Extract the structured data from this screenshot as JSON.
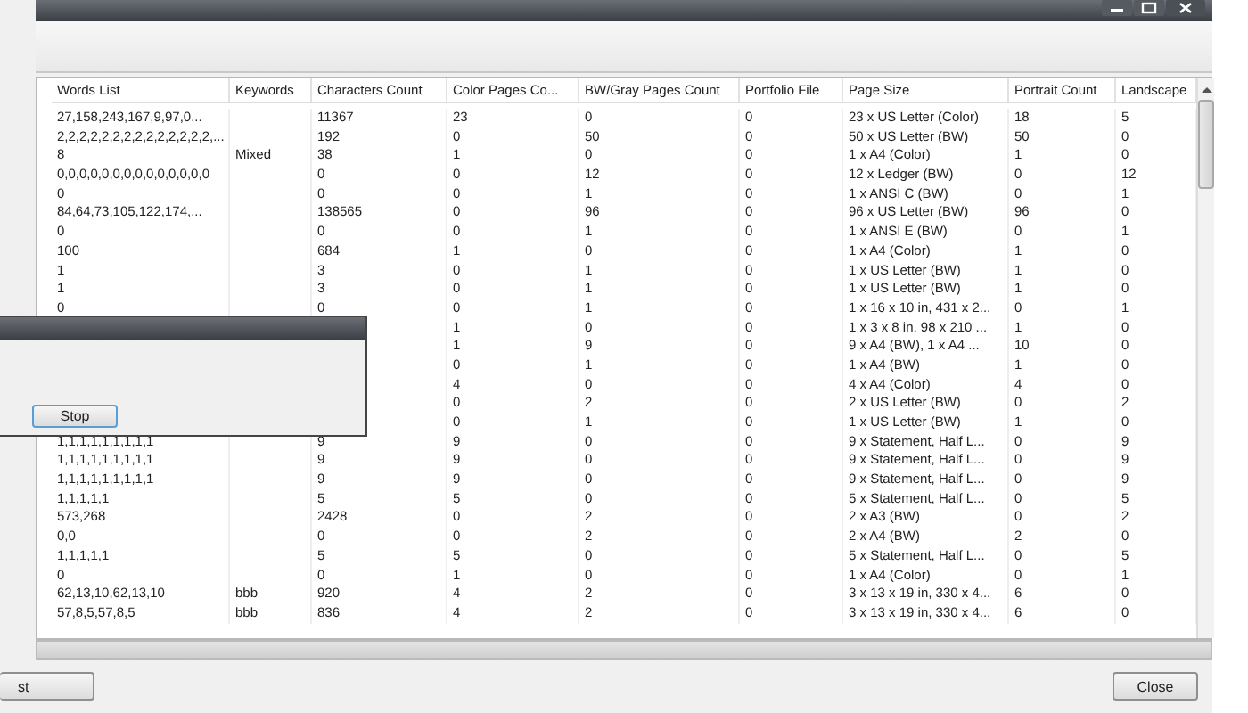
{
  "table": {
    "columns": [
      "Words List",
      "Keywords",
      "Characters Count",
      "Color Pages Co...",
      "BW/Gray Pages Count",
      "Portfolio File",
      "Page Size",
      "Portrait Count",
      "Landscape"
    ],
    "rows": [
      {
        "words": "27,158,243,167,9,97,0...",
        "chars": "11367",
        "color_pages": "23",
        "bw_pages": "0",
        "portfolio": "0",
        "page_size": "23 x US Letter  (Color)",
        "portrait": "18",
        "landscape": "5"
      },
      {
        "words": "2,2,2,2,2,2,2,2,2,2,2,2,2,2,...",
        "chars": "192",
        "color_pages": "0",
        "bw_pages": "50",
        "portfolio": "0",
        "page_size": "50 x US Letter  (BW)",
        "portrait": "50",
        "landscape": "0"
      },
      {
        "words": "8",
        "keywords": "Mixed",
        "chars": "38",
        "color_pages": "1",
        "bw_pages": "0",
        "portfolio": "0",
        "page_size": "1 x A4  (Color)",
        "portrait": "1",
        "landscape": "0"
      },
      {
        "words": "0,0,0,0,0,0,0,0,0,0,0,0,0,0",
        "chars": "0",
        "color_pages": "0",
        "bw_pages": "12",
        "portfolio": "0",
        "page_size": "12 x Ledger  (BW)",
        "portrait": "0",
        "landscape": "12"
      },
      {
        "words": "0",
        "chars": "0",
        "color_pages": "0",
        "bw_pages": "1",
        "portfolio": "0",
        "page_size": "1 x ANSI C  (BW)",
        "portrait": "0",
        "landscape": "1"
      },
      {
        "words": "84,64,73,105,122,174,...",
        "chars": "138565",
        "color_pages": "0",
        "bw_pages": "96",
        "portfolio": "0",
        "page_size": "96 x US Letter  (BW)",
        "portrait": "96",
        "landscape": "0"
      },
      {
        "words": "0",
        "chars": "0",
        "color_pages": "0",
        "bw_pages": "1",
        "portfolio": "0",
        "page_size": "1 x ANSI E  (BW)",
        "portrait": "0",
        "landscape": "1"
      },
      {
        "words": "100",
        "chars": "684",
        "color_pages": "1",
        "bw_pages": "0",
        "portfolio": "0",
        "page_size": "1 x A4  (Color)",
        "portrait": "1",
        "landscape": "0"
      },
      {
        "words": "1",
        "chars": "3",
        "color_pages": "0",
        "bw_pages": "1",
        "portfolio": "0",
        "page_size": "1 x US Letter  (BW)",
        "portrait": "1",
        "landscape": "0"
      },
      {
        "words": "1",
        "chars": "3",
        "color_pages": "0",
        "bw_pages": "1",
        "portfolio": "0",
        "page_size": "1 x US Letter  (BW)",
        "portrait": "1",
        "landscape": "0"
      },
      {
        "words": "0",
        "chars": "0",
        "color_pages": "0",
        "bw_pages": "1",
        "portfolio": "0",
        "page_size": "1 x 16 x 10 in, 431 x 2...",
        "portrait": "0",
        "landscape": "1"
      },
      {
        "color_pages": "1",
        "bw_pages": "0",
        "portfolio": "0",
        "page_size": "1 x 3 x 8 in, 98 x 210 ...",
        "portrait": "1",
        "landscape": "0"
      },
      {
        "color_pages": "1",
        "bw_pages": "9",
        "portfolio": "0",
        "page_size": "9 x A4  (BW), 1 x A4  ...",
        "portrait": "10",
        "landscape": "0"
      },
      {
        "color_pages": "0",
        "bw_pages": "1",
        "portfolio": "0",
        "page_size": "1 x A4  (BW)",
        "portrait": "1",
        "landscape": "0"
      },
      {
        "color_pages": "4",
        "bw_pages": "0",
        "portfolio": "0",
        "page_size": "4 x A4  (Color)",
        "portrait": "4",
        "landscape": "0"
      },
      {
        "color_pages": "0",
        "bw_pages": "2",
        "portfolio": "0",
        "page_size": "2 x US Letter  (BW)",
        "portrait": "0",
        "landscape": "2"
      },
      {
        "color_pages": "0",
        "bw_pages": "1",
        "portfolio": "0",
        "page_size": "1 x US Letter  (BW)",
        "portrait": "1",
        "landscape": "0"
      },
      {
        "words": "1,1,1,1,1,1,1,1,1",
        "chars": "9",
        "color_pages": "9",
        "bw_pages": "0",
        "portfolio": "0",
        "page_size": "9 x Statement, Half L...",
        "portrait": "0",
        "landscape": "9"
      },
      {
        "words": "1,1,1,1,1,1,1,1,1",
        "chars": "9",
        "color_pages": "9",
        "bw_pages": "0",
        "portfolio": "0",
        "page_size": "9 x Statement, Half L...",
        "portrait": "0",
        "landscape": "9"
      },
      {
        "words": "1,1,1,1,1,1,1,1,1",
        "chars": "9",
        "color_pages": "9",
        "bw_pages": "0",
        "portfolio": "0",
        "page_size": "9 x Statement, Half L...",
        "portrait": "0",
        "landscape": "9"
      },
      {
        "words": "1,1,1,1,1",
        "chars": "5",
        "color_pages": "5",
        "bw_pages": "0",
        "portfolio": "0",
        "page_size": "5 x Statement, Half L...",
        "portrait": "0",
        "landscape": "5"
      },
      {
        "words": "573,268",
        "chars": "2428",
        "color_pages": "0",
        "bw_pages": "2",
        "portfolio": "0",
        "page_size": "2 x A3  (BW)",
        "portrait": "0",
        "landscape": "2"
      },
      {
        "words": "0,0",
        "chars": "0",
        "color_pages": "0",
        "bw_pages": "2",
        "portfolio": "0",
        "page_size": "2 x A4  (BW)",
        "portrait": "2",
        "landscape": "0"
      },
      {
        "words": "1,1,1,1,1",
        "chars": "5",
        "color_pages": "5",
        "bw_pages": "0",
        "portfolio": "0",
        "page_size": "5 x Statement, Half L...",
        "portrait": "0",
        "landscape": "5"
      },
      {
        "words": "0",
        "chars": "0",
        "color_pages": "1",
        "bw_pages": "0",
        "portfolio": "0",
        "page_size": "1 x A4  (Color)",
        "portrait": "0",
        "landscape": "1"
      },
      {
        "words": "62,13,10,62,13,10",
        "keywords": "bbb",
        "chars": "920",
        "color_pages": "4",
        "bw_pages": "2",
        "portfolio": "0",
        "page_size": "3 x 13 x 19 in, 330 x 4...",
        "portrait": "6",
        "landscape": "0"
      },
      {
        "words": "57,8,5,57,8,5",
        "keywords": "bbb",
        "chars": "836",
        "color_pages": "4",
        "bw_pages": "2",
        "portfolio": "0",
        "page_size": "3 x 13 x 19 in, 330 x 4...",
        "portrait": "6",
        "landscape": "0"
      }
    ]
  },
  "dialog": {
    "button": "Stop"
  },
  "buttons": [
    "st",
    "Close"
  ]
}
